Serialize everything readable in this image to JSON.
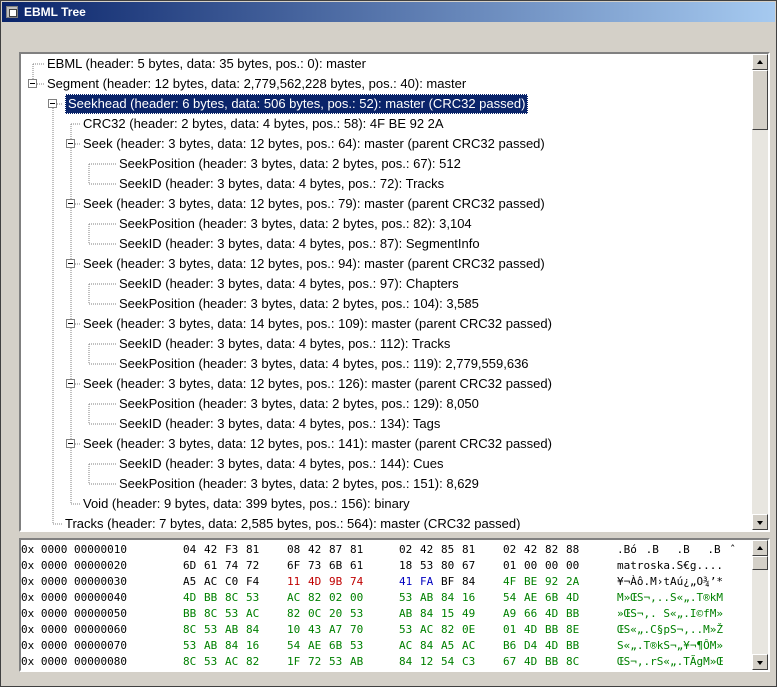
{
  "window": {
    "title": "EBML Tree"
  },
  "tree": {
    "rows": [
      {
        "text": "EBML (header: 5 bytes, data: 35 bytes, pos.: 0): master",
        "level": 0,
        "expander": false
      },
      {
        "text": "Segment (header: 12 bytes, data: 2,779,562,228 bytes, pos.: 40): master",
        "level": 0,
        "expander": true
      },
      {
        "text": "Seekhead (header: 6 bytes, data: 506 bytes, pos.: 52): master (CRC32 passed)",
        "level": 1,
        "expander": true,
        "selected": true
      },
      {
        "text": "CRC32 (header: 2 bytes, data: 4 bytes, pos.: 58): 4F BE 92 2A",
        "level": 2,
        "expander": false
      },
      {
        "text": "Seek (header: 3 bytes, data: 12 bytes, pos.: 64): master (parent CRC32 passed)",
        "level": 2,
        "expander": true
      },
      {
        "text": "SeekPosition (header: 3 bytes, data: 2 bytes, pos.: 67): 512",
        "level": 3,
        "expander": false
      },
      {
        "text": "SeekID (header: 3 bytes, data: 4 bytes, pos.: 72):  Tracks",
        "level": 3,
        "expander": false
      },
      {
        "text": "Seek (header: 3 bytes, data: 12 bytes, pos.: 79): master (parent CRC32 passed)",
        "level": 2,
        "expander": true
      },
      {
        "text": "SeekPosition (header: 3 bytes, data: 2 bytes, pos.: 82): 3,104",
        "level": 3,
        "expander": false
      },
      {
        "text": "SeekID (header: 3 bytes, data: 4 bytes, pos.: 87):  SegmentInfo",
        "level": 3,
        "expander": false
      },
      {
        "text": "Seek (header: 3 bytes, data: 12 bytes, pos.: 94): master (parent CRC32 passed)",
        "level": 2,
        "expander": true
      },
      {
        "text": "SeekID (header: 3 bytes, data: 4 bytes, pos.: 97):  Chapters",
        "level": 3,
        "expander": false
      },
      {
        "text": "SeekPosition (header: 3 bytes, data: 2 bytes, pos.: 104): 3,585",
        "level": 3,
        "expander": false
      },
      {
        "text": "Seek (header: 3 bytes, data: 14 bytes, pos.: 109): master (parent CRC32 passed)",
        "level": 2,
        "expander": true
      },
      {
        "text": "SeekID (header: 3 bytes, data: 4 bytes, pos.: 112):  Tracks",
        "level": 3,
        "expander": false
      },
      {
        "text": "SeekPosition (header: 3 bytes, data: 4 bytes, pos.: 119): 2,779,559,636",
        "level": 3,
        "expander": false
      },
      {
        "text": "Seek (header: 3 bytes, data: 12 bytes, pos.: 126): master (parent CRC32 passed)",
        "level": 2,
        "expander": true
      },
      {
        "text": "SeekPosition (header: 3 bytes, data: 2 bytes, pos.: 129): 8,050",
        "level": 3,
        "expander": false
      },
      {
        "text": "SeekID (header: 3 bytes, data: 4 bytes, pos.: 134):  Tags",
        "level": 3,
        "expander": false
      },
      {
        "text": "Seek (header: 3 bytes, data: 12 bytes, pos.: 141): master (parent CRC32 passed)",
        "level": 2,
        "expander": true
      },
      {
        "text": "SeekID (header: 3 bytes, data: 4 bytes, pos.: 144):  Cues",
        "level": 3,
        "expander": false
      },
      {
        "text": "SeekPosition (header: 3 bytes, data: 2 bytes, pos.: 151): 8,629",
        "level": 3,
        "expander": false
      },
      {
        "text": "Void (header: 9 bytes, data: 399 bytes, pos.: 156): binary",
        "level": 2,
        "expander": false
      },
      {
        "text": "Tracks (header: 7 bytes, data: 2,585 bytes, pos.: 564): master (CRC32 passed)",
        "level": 1,
        "expander": false
      }
    ]
  },
  "hex": {
    "rows": [
      {
        "offset": "0x 0000 00000010",
        "bytes": [
          "04",
          "42",
          "F3",
          "81",
          "08",
          "42",
          "87",
          "81",
          "02",
          "42",
          "85",
          "81",
          "02",
          "42",
          "82",
          "88"
        ],
        "colors": [
          "",
          "",
          "",
          "",
          "",
          "",
          "",
          "",
          "",
          "",
          "",
          "",
          "",
          "",
          "",
          ""
        ],
        "ascii": ".Bó.B.B.Bˆ"
      },
      {
        "offset": "0x 0000 00000020",
        "bytes": [
          "6D",
          "61",
          "74",
          "72",
          "6F",
          "73",
          "6B",
          "61",
          "18",
          "53",
          "80",
          "67",
          "01",
          "00",
          "00",
          "00"
        ],
        "colors": [
          "",
          "",
          "",
          "",
          "",
          "",
          "",
          "",
          "",
          "",
          "",
          "",
          "",
          "",
          "",
          ""
        ],
        "ascii": "matroska.S€g...."
      },
      {
        "offset": "0x 0000 00000030",
        "bytes": [
          "A5",
          "AC",
          "C0",
          "F4",
          "11",
          "4D",
          "9B",
          "74",
          "41",
          "FA",
          "BF",
          "84",
          "4F",
          "BE",
          "92",
          "2A"
        ],
        "colors": [
          "",
          "",
          "",
          "",
          "red",
          "red",
          "red",
          "red",
          "blue",
          "blue",
          "",
          "",
          "green",
          "green",
          "green",
          "green"
        ],
        "ascii": "¥¬Àô.M›tAú¿„O¾’*"
      },
      {
        "offset": "0x 0000 00000040",
        "bytes": [
          "4D",
          "BB",
          "8C",
          "53",
          "AC",
          "82",
          "02",
          "00",
          "53",
          "AB",
          "84",
          "16",
          "54",
          "AE",
          "6B",
          "4D"
        ],
        "colors": [
          "green",
          "green",
          "green",
          "green",
          "green",
          "green",
          "green",
          "green",
          "green",
          "green",
          "green",
          "green",
          "green",
          "green",
          "green",
          "green"
        ],
        "ascii": "M»ŒS¬‚..S«„.T®kM"
      },
      {
        "offset": "0x 0000 00000050",
        "bytes": [
          "BB",
          "8C",
          "53",
          "AC",
          "82",
          "0C",
          "20",
          "53",
          "AB",
          "84",
          "15",
          "49",
          "A9",
          "66",
          "4D",
          "BB"
        ],
        "colors": [
          "green",
          "green",
          "green",
          "green",
          "green",
          "green",
          "green",
          "green",
          "green",
          "green",
          "green",
          "green",
          "green",
          "green",
          "green",
          "green"
        ],
        "ascii": "»ŒS¬‚. S«„.I©fM»"
      },
      {
        "offset": "0x 0000 00000060",
        "bytes": [
          "8C",
          "53",
          "AB",
          "84",
          "10",
          "43",
          "A7",
          "70",
          "53",
          "AC",
          "82",
          "0E",
          "01",
          "4D",
          "BB",
          "8E"
        ],
        "colors": [
          "green",
          "green",
          "green",
          "green",
          "green",
          "green",
          "green",
          "green",
          "green",
          "green",
          "green",
          "green",
          "green",
          "green",
          "green",
          "green"
        ],
        "ascii": "ŒS«„.C§pS¬‚..M»Ž"
      },
      {
        "offset": "0x 0000 00000070",
        "bytes": [
          "53",
          "AB",
          "84",
          "16",
          "54",
          "AE",
          "6B",
          "53",
          "AC",
          "84",
          "A5",
          "AC",
          "B6",
          "D4",
          "4D",
          "BB"
        ],
        "colors": [
          "green",
          "green",
          "green",
          "green",
          "green",
          "green",
          "green",
          "green",
          "green",
          "green",
          "green",
          "green",
          "green",
          "green",
          "green",
          "green"
        ],
        "ascii": "S«„.T®kS¬„¥¬¶ÔM»"
      },
      {
        "offset": "0x 0000 00000080",
        "bytes": [
          "8C",
          "53",
          "AC",
          "82",
          "1F",
          "72",
          "53",
          "AB",
          "84",
          "12",
          "54",
          "C3",
          "67",
          "4D",
          "BB",
          "8C"
        ],
        "colors": [
          "green",
          "green",
          "green",
          "green",
          "green",
          "green",
          "green",
          "green",
          "green",
          "green",
          "green",
          "green",
          "green",
          "green",
          "green",
          "green"
        ],
        "ascii": "ŒS¬‚.rS«„.TÃgM»Œ"
      }
    ]
  }
}
